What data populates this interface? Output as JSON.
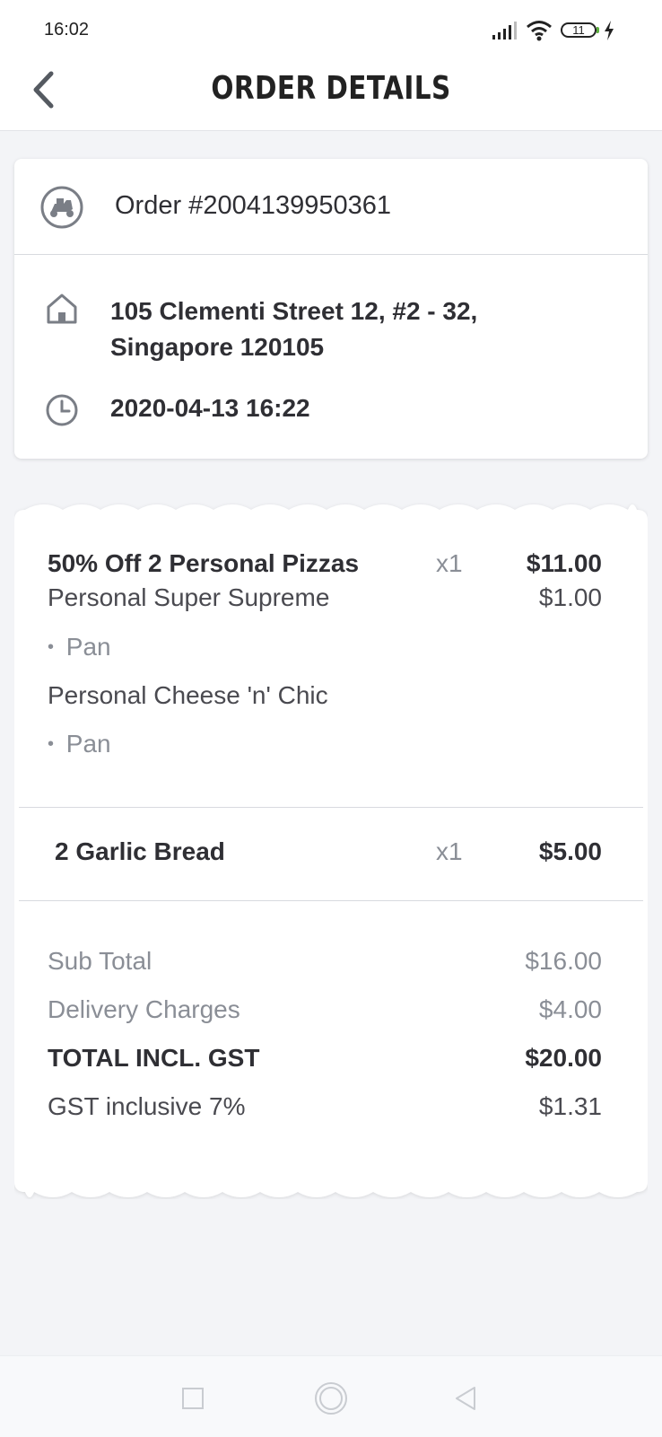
{
  "status_bar": {
    "time": "16:02",
    "battery": "11"
  },
  "header": {
    "title": "ORDER DETAILS"
  },
  "order": {
    "number": "Order #2004139950361",
    "address_line1": "105 Clementi Street 12, #2 - 32,",
    "address_line2": "Singapore 120105",
    "datetime": "2020-04-13 16:22"
  },
  "items": [
    {
      "name": "50% Off 2 Personal Pizzas",
      "qty": "x1",
      "price": "$11.00",
      "sub_items": [
        {
          "name": "Personal Super Supreme",
          "price": "$1.00",
          "option": "Pan"
        },
        {
          "name": "Personal Cheese 'n' Chic",
          "price": "",
          "option": "Pan"
        }
      ]
    },
    {
      "name": "2 Garlic Bread",
      "qty": "x1",
      "price": "$5.00"
    }
  ],
  "totals": {
    "sub_total_label": "Sub Total",
    "sub_total": "$16.00",
    "delivery_label": "Delivery Charges",
    "delivery": "$4.00",
    "total_label": "TOTAL INCL. GST",
    "total": "$20.00",
    "gst_label": "GST inclusive 7%",
    "gst": "$1.31"
  },
  "icons": {
    "back": "back-arrow-icon",
    "order": "delivery-scooter-icon",
    "address": "home-icon",
    "time": "clock-icon"
  },
  "colors": {
    "icon_gray": "#7a7e86",
    "text_dark": "#2f2f34",
    "muted": "#8a8e96",
    "background": "#f3f4f7"
  }
}
